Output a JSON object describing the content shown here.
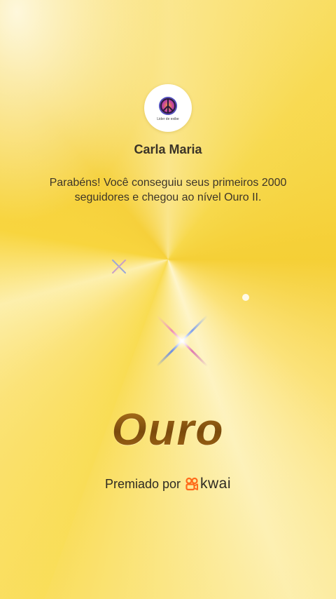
{
  "profile": {
    "avatar_caption": "Lider de exibe",
    "name": "Carla Maria"
  },
  "message": {
    "line1": "Parabéns! Você conseguiu seus primeiros 2000",
    "line2": "seguidores e chegou ao nível Ouro II."
  },
  "level": {
    "title": "Ouro"
  },
  "award": {
    "label": "Premiado por",
    "brand": "kwai",
    "brand_icon": "kwai-logo-icon",
    "brand_color": "#ff6a1a"
  },
  "colors": {
    "background": "#f7d94a",
    "level_text": "#8a5a12"
  }
}
